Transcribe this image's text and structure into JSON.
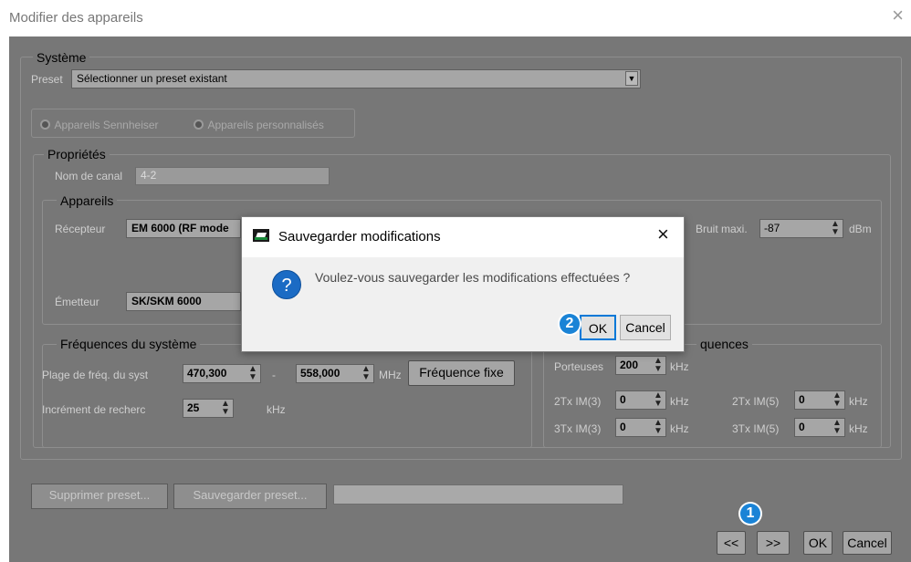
{
  "window": {
    "title": "Modifier des appareils",
    "close": "×"
  },
  "systeme": {
    "group_title": "Système",
    "preset_label": "Preset",
    "preset_value": "Sélectionner un preset existant",
    "radio_sennheiser": "Appareils Sennheiser",
    "radio_custom": "Appareils personnalisés"
  },
  "proprietes": {
    "group_title": "Propriétés",
    "channel_label": "Nom de canal",
    "channel_value": "4-2"
  },
  "appareils": {
    "group_title": "Appareils",
    "receiver_label": "Récepteur",
    "receiver_value": "EM 6000 (RF mode",
    "transmitter_label": "Émetteur",
    "transmitter_value": "SK/SKM 6000",
    "noise_label": "Bruit maxi.",
    "noise_value": "-87",
    "noise_unit": "dBm"
  },
  "frequences": {
    "group_title": "Fréquences du système",
    "range_label": "Plage de fréq. du syst",
    "range_from": "470,300",
    "range_sep": "-",
    "range_to": "558,000",
    "range_unit": "MHz",
    "fixed_button": "Fréquence fixe",
    "step_label": "Incrément de recherc",
    "step_value": "25",
    "step_unit": "kHz"
  },
  "intermod": {
    "group_title": "quences",
    "carriers_label": "Porteuses",
    "carriers_value": "200",
    "carriers_unit": "kHz",
    "im2x3_label": "2Tx IM(3)",
    "im2x3_value": "0",
    "im2x3_unit": "kHz",
    "im2x5_label": "2Tx IM(5)",
    "im2x5_value": "0",
    "im2x5_unit": "kHz",
    "im3x3_label": "3Tx IM(3)",
    "im3x3_value": "0",
    "im3x3_unit": "kHz",
    "im3x5_label": "3Tx IM(5)",
    "im3x5_value": "0",
    "im3x5_unit": "kHz"
  },
  "presets": {
    "delete_button": "Supprimer preset...",
    "save_button": "Sauvegarder preset...",
    "name_value": ""
  },
  "footer": {
    "prev": "<<",
    "next": ">>",
    "ok": "OK",
    "cancel": "Cancel"
  },
  "dialog": {
    "title": "Sauvegarder modifications",
    "close": "×",
    "icon": "?",
    "message": "Voulez-vous sauvegarder les modifications effectuées ?",
    "ok": "OK",
    "cancel": "Cancel"
  },
  "badges": {
    "one": "1",
    "two": "2"
  }
}
